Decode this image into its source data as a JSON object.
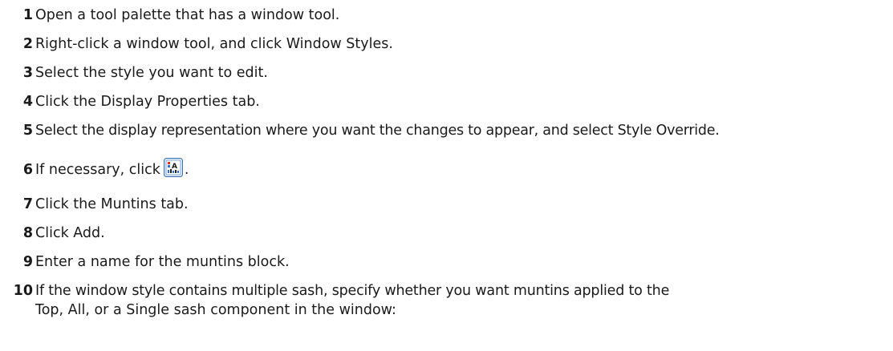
{
  "steps": [
    {
      "n": "1",
      "text": "Open a tool palette that has a window tool."
    },
    {
      "n": "2",
      "text": "Right-click a window tool, and click Window Styles."
    },
    {
      "n": "3",
      "text": "Select the style you want to edit."
    },
    {
      "n": "4",
      "text": "Click the Display Properties tab."
    },
    {
      "n": "5",
      "text": "Select the display representation where you want the changes to appear, and select Style Override."
    },
    {
      "n": "6",
      "text": "If necessary, click",
      "after": "."
    },
    {
      "n": "7",
      "text": "Click the Muntins tab."
    },
    {
      "n": "8",
      "text": "Click Add."
    },
    {
      "n": "9",
      "text": "Enter a name for the muntins block."
    },
    {
      "n": "10",
      "text": "If the window style contains multiple sash, specify whether you want muntins applied to the",
      "continuation": "Top, All, or a Single sash component in the window:"
    }
  ],
  "icons": {
    "step6_button": "edit-display-properties-icon"
  },
  "colors": {
    "text": "#1a1a1a",
    "icon_border": "#3c6eb4",
    "icon_fill": "#dce9f7"
  }
}
